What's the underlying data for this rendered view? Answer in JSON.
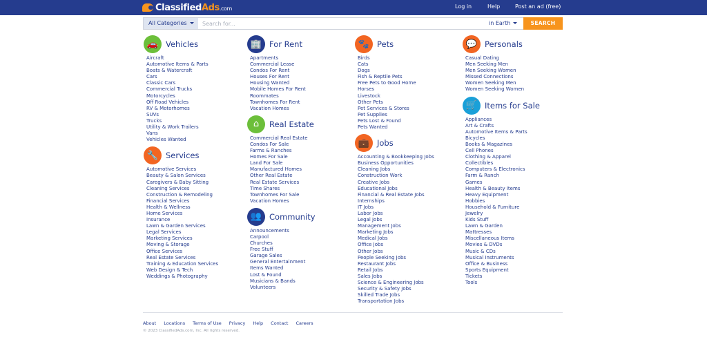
{
  "brand": {
    "part1": "Classified",
    "part2": "Ads",
    "part3": ".com"
  },
  "topnav": {
    "login": "Log in",
    "help": "Help",
    "post": "Post an ad (free)"
  },
  "search": {
    "category_label": "All Categories",
    "placeholder": "Search for...",
    "location": "in Earth",
    "button": "SEARCH"
  },
  "columns": [
    {
      "sections": [
        {
          "title": "Vehicles",
          "icon": "car-icon",
          "color": "#6cbf3a",
          "glyph": "🚗",
          "items": [
            "Aircraft",
            "Automotive Items & Parts",
            "Boats & Watercraft",
            "Cars",
            "Classic Cars",
            "Commercial Trucks",
            "Motorcycles",
            "Off Road Vehicles",
            "RV & Motorhomes",
            "SUVs",
            "Trucks",
            "Utility & Work Trailers",
            "Vans",
            "Vehicles Wanted"
          ]
        },
        {
          "title": "Services",
          "icon": "wrench-icon",
          "color": "#f26522",
          "glyph": "🔧",
          "items": [
            "Automotive Services",
            "Beauty & Salon Services",
            "Caregivers & Baby Sitting",
            "Cleaning Services",
            "Construction & Remodeling",
            "Financial Services",
            "Health & Wellness",
            "Home Services",
            "Insurance",
            "Lawn & Garden Services",
            "Legal Services",
            "Marketing Services",
            "Moving & Storage",
            "Office Services",
            "Real Estate Services",
            "Training & Education Services",
            "Web Design & Tech",
            "Weddings & Photography"
          ]
        }
      ]
    },
    {
      "sections": [
        {
          "title": "For Rent",
          "icon": "building-icon",
          "color": "#253c8e",
          "glyph": "🏢",
          "items": [
            "Apartments",
            "Commercial Lease",
            "Condos For Rent",
            "Houses For Rent",
            "Housing Wanted",
            "Mobile Homes For Rent",
            "Roommates",
            "Townhomes For Rent",
            "Vacation Homes"
          ]
        },
        {
          "title": "Real Estate",
          "icon": "house-icon",
          "color": "#6cbf3a",
          "glyph": "⌂",
          "items": [
            "Commercial Real Estate",
            "Condos For Sale",
            "Farms & Ranches",
            "Homes For Sale",
            "Land For Sale",
            "Manufactured Homes",
            "Other Real Estate",
            "Real Estate Services",
            "Time Shares",
            "Townhomes For Sale",
            "Vacation Homes"
          ]
        },
        {
          "title": "Community",
          "icon": "people-icon",
          "color": "#253c8e",
          "glyph": "👥",
          "items": [
            "Announcements",
            "Carpool",
            "Churches",
            "Free Stuff",
            "Garage Sales",
            "General Entertainment",
            "Items Wanted",
            "Lost & Found",
            "Musicians & Bands",
            "Volunteers"
          ]
        }
      ]
    },
    {
      "sections": [
        {
          "title": "Pets",
          "icon": "paw-icon",
          "color": "#f26522",
          "glyph": "🐾",
          "items": [
            "Birds",
            "Cats",
            "Dogs",
            "Fish & Reptile Pets",
            "Free Pets to Good Home",
            "Horses",
            "Livestock",
            "Other Pets",
            "Pet Services & Stores",
            "Pet Supplies",
            "Pets Lost & Found",
            "Pets Wanted"
          ]
        },
        {
          "title": "Jobs",
          "icon": "briefcase-icon",
          "color": "#f26522",
          "glyph": "💼",
          "items": [
            "Accounting & Bookkeeping Jobs",
            "Business Opportunities",
            "Cleaning Jobs",
            "Construction Work",
            "Creative Jobs",
            "Educational Jobs",
            "Financial & Real Estate Jobs",
            "Internships",
            "IT Jobs",
            "Labor Jobs",
            "Legal Jobs",
            "Management Jobs",
            "Marketing Jobs",
            "Medical Jobs",
            "Office Jobs",
            "Other Jobs",
            "People Seeking Jobs",
            "Restaurant Jobs",
            "Retail Jobs",
            "Sales Jobs",
            "Science & Engineering Jobs",
            "Security & Safety Jobs",
            "Skilled Trade Jobs",
            "Transportation Jobs"
          ]
        }
      ]
    },
    {
      "sections": [
        {
          "title": "Personals",
          "icon": "chat-heart-icon",
          "color": "#f26522",
          "glyph": "💬",
          "items": [
            "Casual Dating",
            "Men Seeking Men",
            "Men Seeking Women",
            "Missed Connections",
            "Women Seeking Men",
            "Women Seeking Women"
          ]
        },
        {
          "title": "Items for Sale",
          "icon": "cart-icon",
          "color": "#1aa0d8",
          "glyph": "🛒",
          "items": [
            "Appliances",
            "Art & Crafts",
            "Automotive Items & Parts",
            "Bicycles",
            "Books & Magazines",
            "Cell Phones",
            "Clothing & Apparel",
            "Collectibles",
            "Computers & Electronics",
            "Farm & Ranch",
            "Games",
            "Health & Beauty Items",
            "Heavy Equipment",
            "Hobbies",
            "Household & Furniture",
            "Jewelry",
            "Kids Stuff",
            "Lawn & Garden",
            "Mattresses",
            "Miscellaneous Items",
            "Movies & DVDs",
            "Music & CDs",
            "Musical Instruments",
            "Office & Business",
            "Sports Equipment",
            "Tickets",
            "Tools"
          ]
        }
      ]
    }
  ],
  "footer": {
    "links": [
      "About",
      "Locations",
      "Terms of Use",
      "Privacy",
      "Help",
      "Contact",
      "Careers"
    ],
    "copyright": "© 2023 ClassifiedAds.com, Inc. All rights reserved."
  }
}
